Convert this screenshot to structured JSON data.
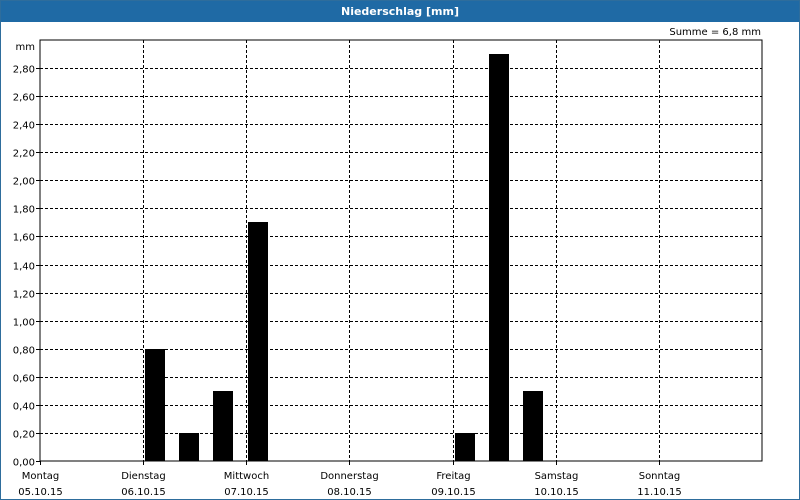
{
  "window": {
    "title": "Niederschlag [mm]"
  },
  "summary": "Summe = 6,8 mm",
  "chart_data": {
    "type": "bar",
    "title": "Niederschlag [mm]",
    "ylabel": "mm",
    "xlabel": "",
    "ylim": [
      0,
      3.0
    ],
    "yticks": [
      "0,00",
      "0,20",
      "0,40",
      "0,60",
      "0,80",
      "1,00",
      "1,20",
      "1,40",
      "1,60",
      "1,80",
      "2,00",
      "2,20",
      "2,40",
      "2,60",
      "2,80"
    ],
    "ytick_values": [
      0,
      0.2,
      0.4,
      0.6,
      0.8,
      1.0,
      1.2,
      1.4,
      1.6,
      1.8,
      2.0,
      2.2,
      2.4,
      2.6,
      2.8
    ],
    "days": [
      {
        "name": "Montag",
        "date": "05.10.15"
      },
      {
        "name": "Dienstag",
        "date": "06.10.15"
      },
      {
        "name": "Mittwoch",
        "date": "07.10.15"
      },
      {
        "name": "Donnerstag",
        "date": "08.10.15"
      },
      {
        "name": "Freitag",
        "date": "09.10.15"
      },
      {
        "name": "Samstag",
        "date": "10.10.15"
      },
      {
        "name": "Sonntag",
        "date": "11.10.15"
      }
    ],
    "bars": [
      {
        "day": 1,
        "slot": 0,
        "value": 0.8
      },
      {
        "day": 1,
        "slot": 1,
        "value": 0.2
      },
      {
        "day": 1,
        "slot": 2,
        "value": 0.5
      },
      {
        "day": 2,
        "slot": 0,
        "value": 1.7
      },
      {
        "day": 4,
        "slot": 0,
        "value": 0.2
      },
      {
        "day": 4,
        "slot": 1,
        "value": 2.9
      },
      {
        "day": 4,
        "slot": 2,
        "value": 0.5
      }
    ],
    "grid": true,
    "bar_color": "#000000"
  }
}
